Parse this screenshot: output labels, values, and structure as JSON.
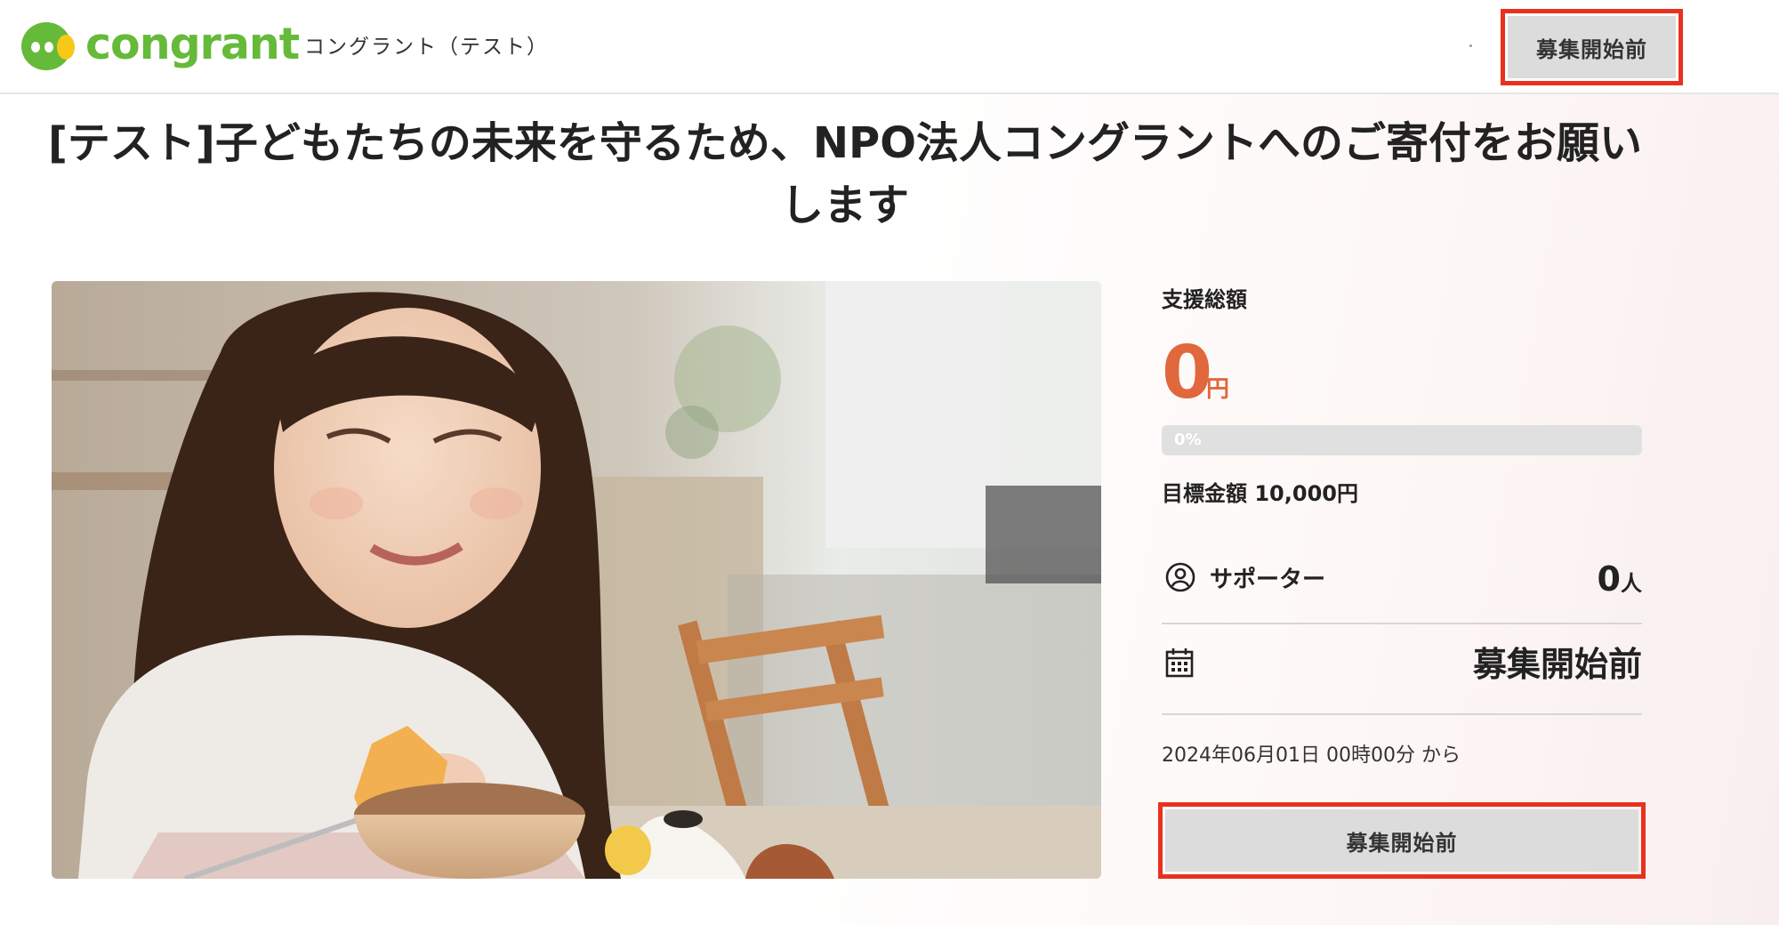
{
  "header": {
    "brand": "congrant",
    "org_name": "コングラント（テスト）",
    "cta_label": "募集開始前"
  },
  "campaign": {
    "title": "[テスト]子どもたちの未来を守るため、NPO法人コングラントへのご寄付をお願いします",
    "hero_alt": "girl eating rice ball and simmered daikon"
  },
  "stats": {
    "total_label": "支援総額",
    "total_amount": "0",
    "total_unit": "円",
    "progress_percent": 0,
    "progress_label": "0%",
    "goal_text": "目標金額 10,000円",
    "supporters_label": "サポーター",
    "supporters_count": "0",
    "supporters_unit": "人",
    "status_value": "募集開始前",
    "start_date": "2024年06月01日 00時00分 から",
    "cta_label": "募集開始前"
  },
  "colors": {
    "brand_green": "#65ba39",
    "brand_yellow": "#f6c918",
    "accent_orange": "#e0683c",
    "highlight_red": "#e8311f",
    "button_gray": "#dcdcdc"
  },
  "icons": {
    "supporters": "user-circle-icon",
    "status": "calendar-icon"
  }
}
